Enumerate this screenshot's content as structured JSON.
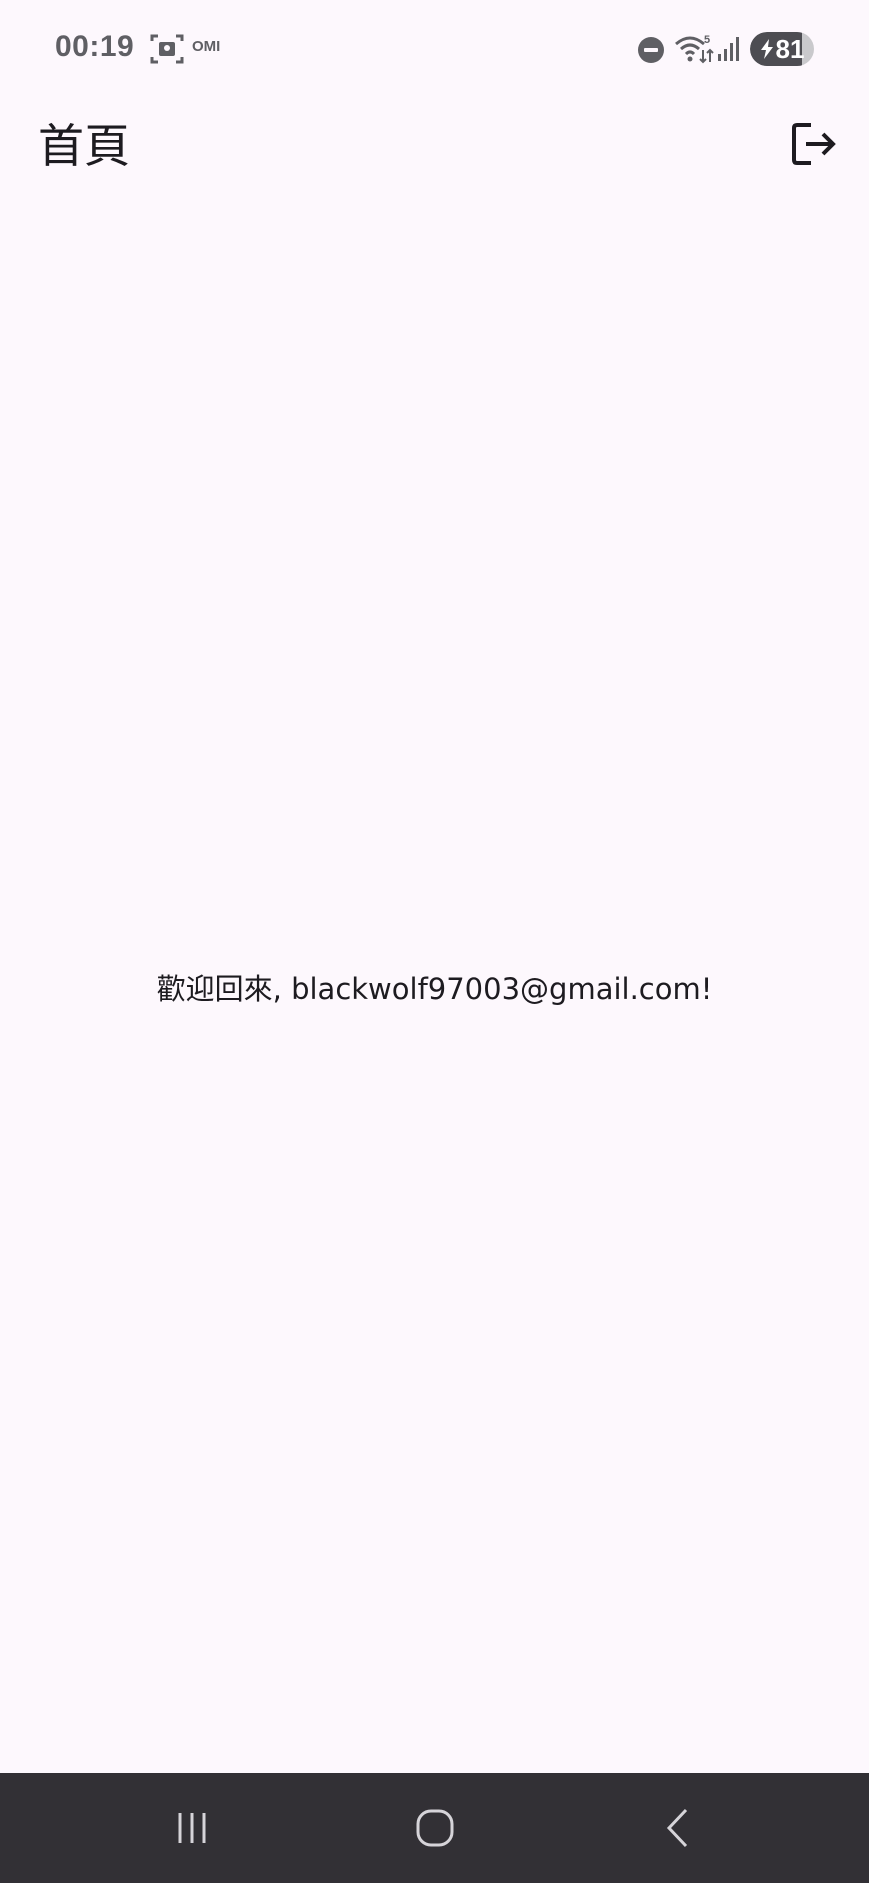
{
  "status_bar": {
    "time": "00:19",
    "notification_label": "OMI",
    "battery_level": "81",
    "battery_percent": 81,
    "icons": [
      "screenshot-icon",
      "do-not-disturb-icon",
      "wifi-icon",
      "cell-signal-icon",
      "battery-charging-icon"
    ]
  },
  "app_bar": {
    "title": "首頁",
    "logout_icon": "logout-icon"
  },
  "main": {
    "welcome_message": "歡迎回來, blackwolf97003@gmail.com!"
  },
  "nav_bar": {
    "icons": [
      "recents-icon",
      "home-icon",
      "back-icon"
    ]
  },
  "colors": {
    "background": "#fdf8fd",
    "text": "#1d1b20",
    "status_icons": "#5f5f64",
    "nav_bar": "#323035"
  }
}
